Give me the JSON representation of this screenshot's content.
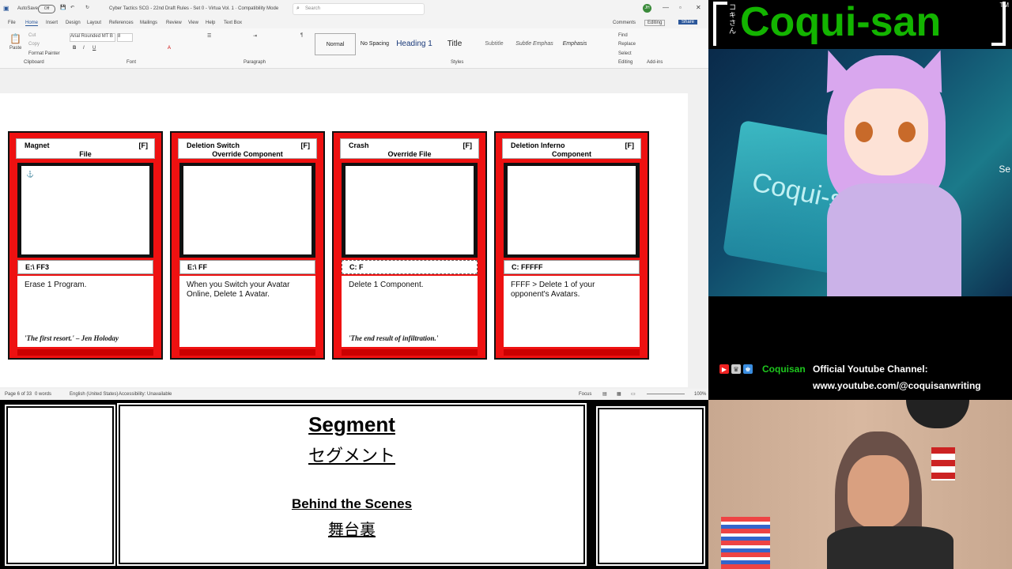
{
  "word": {
    "title": "Cyber Tactics SCG - 22nd Draft Rules - Set 0 - Virtua Vol. 1  ·  Compatibility Mode",
    "autosave": "AutoSave",
    "autosave_state": "Off",
    "search_placeholder": "Search",
    "menus": [
      "File",
      "Home",
      "Insert",
      "Design",
      "Layout",
      "References",
      "Mailings",
      "Review",
      "View",
      "Help",
      "Text Box"
    ],
    "comments": "Comments",
    "editing": "Editing",
    "share": "Share",
    "font_name": "Arial Rounded MT B",
    "font_size": "8",
    "styles": [
      "Normal",
      "No Spacing",
      "Heading 1",
      "Title",
      "Subtitle",
      "Subtle Emphas",
      "Emphasis"
    ],
    "groups": [
      "Clipboard",
      "Font",
      "Paragraph",
      "Styles",
      "Editing",
      "Add-ins"
    ],
    "find": "Find",
    "replace": "Replace",
    "select": "Select",
    "paste": "Paste",
    "cut": "Cut",
    "copy": "Copy",
    "format_painter": "Format Painter",
    "status": {
      "page": "Page 6 of 33",
      "words": "0 words",
      "language": "English (United States)",
      "accessibility": "Accessibility: Unavailable",
      "focus": "Focus",
      "zoom": "100%"
    }
  },
  "cards": [
    {
      "name": "Magnet",
      "tag": "[F]",
      "type": "File",
      "cost": "E:\\ FF3",
      "effect": "Erase 1 Program.",
      "flavor": "'The first resort.' – Jen Holoday"
    },
    {
      "name": "Deletion Switch",
      "tag": "[F]",
      "type": "Override Component",
      "cost": "E:\\ FF",
      "effect": "When you Switch your Avatar Online, Delete 1 Avatar.",
      "flavor": ""
    },
    {
      "name": "Crash",
      "tag": "[F]",
      "type": "Override File",
      "cost": "C: F",
      "effect": "Delete 1 Component.",
      "flavor": "'The end result of infiltration.'"
    },
    {
      "name": "Deletion Inferno",
      "tag": "[F]",
      "type": "Component",
      "cost": "C: FFFFF",
      "effect": "FFFF > Delete 1 of your opponent's Avatars.",
      "flavor": ""
    }
  ],
  "logo": {
    "text": "Coqui-san",
    "kana": "コキさん",
    "tm": "TM"
  },
  "anime": {
    "laptop_text": "Coqui-san",
    "side_text": "Se"
  },
  "youtube": {
    "name": "Coquisan",
    "title": "Official Youtube Channel:",
    "url": "www.youtube.com/@coquisanwriting"
  },
  "segment": {
    "title": "Segment",
    "title_jp": "セグメント",
    "subtitle": "Behind the Scenes",
    "subtitle_jp": "舞台裏"
  },
  "colors": {
    "card_red": "#ee1111",
    "logo_green": "#13b400",
    "yt_name_green": "#1ec81e"
  }
}
